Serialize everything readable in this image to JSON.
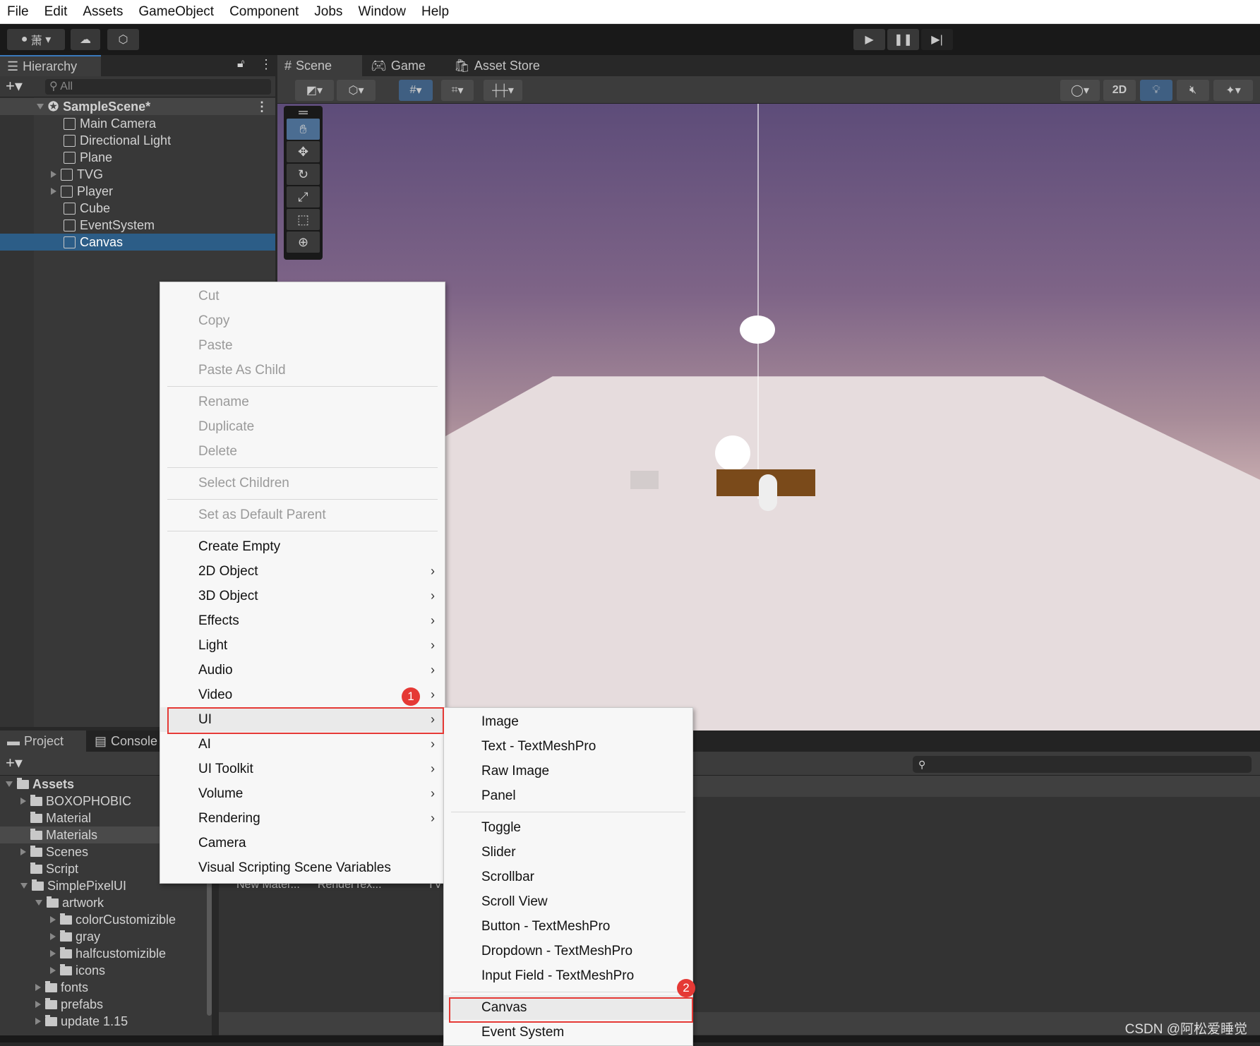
{
  "menubar": [
    "File",
    "Edit",
    "Assets",
    "GameObject",
    "Component",
    "Jobs",
    "Window",
    "Help"
  ],
  "toolbar": {
    "account": "萧",
    "play_icon": "play-icon",
    "pause_icon": "pause-icon",
    "step_icon": "step-icon"
  },
  "hierarchy": {
    "tab": "Hierarchy",
    "search_placeholder": "All",
    "scene": "SampleScene*",
    "items": [
      {
        "label": "Main Camera"
      },
      {
        "label": "Directional Light"
      },
      {
        "label": "Plane"
      },
      {
        "label": "TVG",
        "expandable": true
      },
      {
        "label": "Player",
        "expandable": true
      },
      {
        "label": "Cube"
      },
      {
        "label": "EventSystem"
      },
      {
        "label": "Canvas",
        "selected": true
      }
    ]
  },
  "scene_tabs": [
    "Scene",
    "Game",
    "Asset Store"
  ],
  "scene_toolbar": {
    "mode_2d": "2D"
  },
  "project": {
    "tabs": [
      "Project",
      "Console"
    ],
    "tree": [
      {
        "label": "Assets",
        "depth": 0,
        "open": true
      },
      {
        "label": "BOXOPHOBIC",
        "depth": 1,
        "arrow": true
      },
      {
        "label": "Material",
        "depth": 1
      },
      {
        "label": "Materials",
        "depth": 1,
        "selected": true
      },
      {
        "label": "Scenes",
        "depth": 1,
        "arrow": true
      },
      {
        "label": "Script",
        "depth": 1
      },
      {
        "label": "SimplePixelUI",
        "depth": 1,
        "open": true
      },
      {
        "label": "artwork",
        "depth": 2,
        "open": true
      },
      {
        "label": "colorCustomizible",
        "depth": 3,
        "arrow": true
      },
      {
        "label": "gray",
        "depth": 3,
        "arrow": true
      },
      {
        "label": "halfcustomizible",
        "depth": 3,
        "arrow": true
      },
      {
        "label": "icons",
        "depth": 3,
        "arrow": true
      },
      {
        "label": "fonts",
        "depth": 2,
        "arrow": true
      },
      {
        "label": "prefabs",
        "depth": 2,
        "arrow": true
      },
      {
        "label": "update 1.15",
        "depth": 2,
        "arrow": true
      }
    ],
    "assets_partial": [
      "New Mater...",
      "RenderTex...",
      "TV"
    ]
  },
  "context_menu": [
    {
      "label": "Cut",
      "disabled": true
    },
    {
      "label": "Copy",
      "disabled": true
    },
    {
      "label": "Paste",
      "disabled": true
    },
    {
      "label": "Paste As Child",
      "disabled": true
    },
    {
      "sep": true
    },
    {
      "label": "Rename",
      "disabled": true
    },
    {
      "label": "Duplicate",
      "disabled": true
    },
    {
      "label": "Delete",
      "disabled": true
    },
    {
      "sep": true
    },
    {
      "label": "Select Children",
      "disabled": true
    },
    {
      "sep": true
    },
    {
      "label": "Set as Default Parent",
      "disabled": true
    },
    {
      "sep": true
    },
    {
      "label": "Create Empty"
    },
    {
      "label": "2D Object",
      "sub": true
    },
    {
      "label": "3D Object",
      "sub": true
    },
    {
      "label": "Effects",
      "sub": true
    },
    {
      "label": "Light",
      "sub": true
    },
    {
      "label": "Audio",
      "sub": true
    },
    {
      "label": "Video",
      "sub": true
    },
    {
      "label": "UI",
      "sub": true,
      "highlight": true
    },
    {
      "label": "AI",
      "sub": true
    },
    {
      "label": "UI Toolkit",
      "sub": true
    },
    {
      "label": "Volume",
      "sub": true
    },
    {
      "label": "Rendering",
      "sub": true
    },
    {
      "label": "Camera"
    },
    {
      "label": "Visual Scripting Scene Variables"
    }
  ],
  "ui_submenu": [
    {
      "label": "Image"
    },
    {
      "label": "Text - TextMeshPro"
    },
    {
      "label": "Raw Image"
    },
    {
      "label": "Panel"
    },
    {
      "sep": true
    },
    {
      "label": "Toggle"
    },
    {
      "label": "Slider"
    },
    {
      "label": "Scrollbar"
    },
    {
      "label": "Scroll View"
    },
    {
      "label": "Button - TextMeshPro"
    },
    {
      "label": "Dropdown - TextMeshPro"
    },
    {
      "label": "Input Field - TextMeshPro"
    },
    {
      "sep": true
    },
    {
      "label": "Canvas",
      "highlight": true
    },
    {
      "label": "Event System"
    }
  ],
  "annotations": {
    "step1": "1",
    "step2": "2"
  },
  "watermark": "CSDN @阿松爱睡觉",
  "colors": {
    "selection": "#2c5d87",
    "annotation": "#e53935",
    "sky_top": "#5e4d7a",
    "floor": "#e8dfe0"
  }
}
